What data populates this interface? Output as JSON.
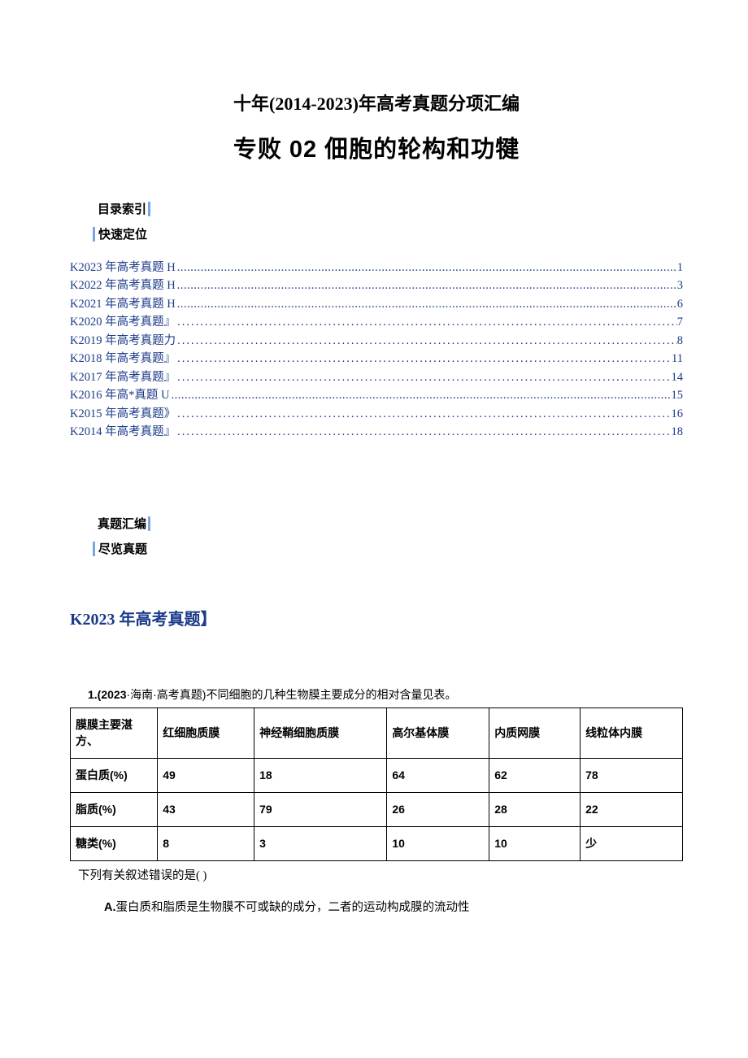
{
  "titles": {
    "line1": "十年(2014-2023)年高考真题分项汇编",
    "line2": "专败 02 佃胞的轮构和功犍"
  },
  "hdr1": {
    "a": "目录索引",
    "b": "快速定位"
  },
  "toc": [
    {
      "label": "K2023 年高考真题 H",
      "page": "1",
      "style": "dense"
    },
    {
      "label": "K2022 年高考真题 H",
      "page": "3",
      "style": "dense"
    },
    {
      "label": "K2021 年高考真题 H",
      "page": "6",
      "style": "dense"
    },
    {
      "label": "K2020 年高考真题』",
      "page": "7",
      "style": "sparse"
    },
    {
      "label": "K2019 年高考真题力",
      "page": "8",
      "style": "sparse"
    },
    {
      "label": "K2018 年高考真题』",
      "page": "11",
      "style": "sparse"
    },
    {
      "label": "K2017 年高考真题』",
      "page": "14",
      "style": "sparse"
    },
    {
      "label": "K2016 年高*真题 U",
      "page": "15",
      "style": "dense"
    },
    {
      "label": "K2015 年高考真题》",
      "page": "16",
      "style": "sparse"
    },
    {
      "label": "K2014 年高考真题』",
      "page": "18",
      "style": "sparse"
    }
  ],
  "hdr2": {
    "a": "真题汇编",
    "b": "尽览真题"
  },
  "section_title": "K2023 年高考真题】",
  "question": {
    "num": "1.(2023",
    "src": "·海南·高考真题)不同细胞的几种生物膜主要成分的相对含量见表。",
    "table": {
      "header": [
        "膜膜主要湛方、",
        "红细胞质膜",
        "神经鞘细胞质膜",
        "高尔基体膜",
        "内质网膜",
        "线粒体内膜"
      ],
      "rows": [
        [
          "蛋白质(%)",
          "49",
          "18",
          "64",
          "62",
          "78"
        ],
        [
          "脂质(%)",
          "43",
          "79",
          "26",
          "28",
          "22"
        ],
        [
          "糖类(%)",
          "8",
          "3",
          "10",
          "10",
          "少"
        ]
      ]
    },
    "after": "下列有关叙述错误的是(          )",
    "optA_letter": "A.",
    "optA": "蛋白质和脂质是生物膜不可或缺的成分，二者的运动构成膜的流动性"
  }
}
